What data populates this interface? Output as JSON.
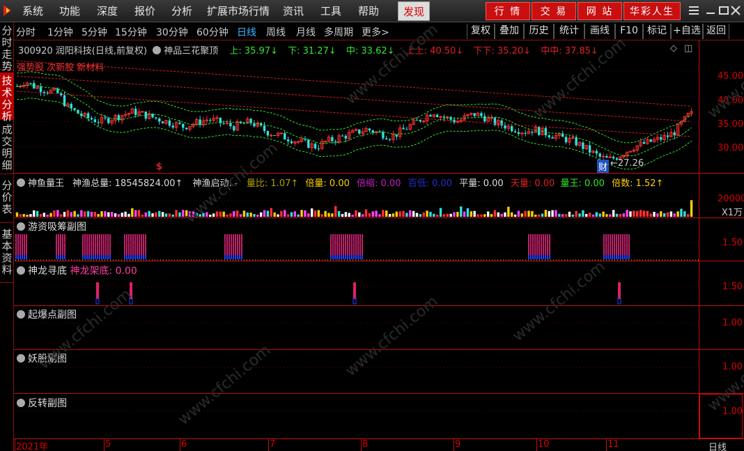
{
  "menubar": {
    "items": [
      "系统",
      "功能",
      "深度",
      "报价",
      "分析",
      "扩展市场行情",
      "资讯",
      "工具",
      "帮助"
    ],
    "highlight": "发现",
    "right_buttons": [
      "行 情",
      "交 易",
      "网 站",
      "华彩人生"
    ]
  },
  "left_rail": {
    "tabs": [
      "分时走势",
      "技术分析",
      "成交明细",
      "分价表",
      "基本资料"
    ],
    "active": "技术分析"
  },
  "periods": {
    "items": [
      "分时",
      "1分钟",
      "5分钟",
      "15分钟",
      "30分钟",
      "60分钟",
      "日线",
      "周线",
      "月线",
      "多周期",
      "更多>"
    ],
    "active": "日线"
  },
  "toolbar": {
    "buttons": [
      "复权",
      "叠加",
      "历史",
      "统计",
      "画线",
      "F10",
      "标记",
      "+自选",
      "返回"
    ]
  },
  "main_chart": {
    "code": "300920",
    "name": "润阳科技(日线,前复权)",
    "indicator": "神品三花聚顶",
    "upper": "上: 35.97↓",
    "lower": "下: 31.27↓",
    "mid": "中: 33.62↓",
    "upup": "上上: 40.50↓",
    "downdown": "下下: 35.20↓",
    "midmid": "中中: 37.85↓",
    "tags": "强势股 次新股 新材料",
    "low_label": "←27.26",
    "cai_badge": "财",
    "s_marker": "$",
    "y_labels": [
      "45.00",
      "40.00",
      "35.00",
      "30.00"
    ]
  },
  "volume_panel": {
    "title": "神鱼量王",
    "total_label": "神渔总量: 18545824.00↑",
    "start_label": "神渔启动: -",
    "ratio": "量比: 1.07↑",
    "multi": "倍量: 0.00",
    "shrink": "倍缩: 0.00",
    "lowest": "百低: 0.00",
    "flat": "平量: 0.00",
    "sky": "天量: 0.00",
    "king": "量王: 0.00",
    "times": "倍数: 1.52↑",
    "y_label": "20000",
    "unit": "X1万"
  },
  "sub_panels": [
    {
      "title": "游资吸筹副图",
      "y_label": "1.50"
    },
    {
      "title": "神龙寻底",
      "value": "神龙架底: 0.00",
      "y_label": "1.50"
    },
    {
      "title": "起爆点副图",
      "y_label": "1.00"
    },
    {
      "title": "妖股副图",
      "y_label": "1.00"
    },
    {
      "title": "反转副图",
      "y_label": "1.00"
    }
  ],
  "dates": [
    "2021年",
    "5",
    "6",
    "7",
    "8",
    "9",
    "10",
    "11"
  ],
  "period_indicator": "日线",
  "watermark": "www.cfchi.com",
  "chart_data": {
    "type": "candlestick",
    "title": "300920 润阳科技(日线,前复权)",
    "ylim": [
      26,
      48
    ],
    "trend": [
      42,
      43,
      42,
      41.5,
      41,
      40.5,
      38,
      37,
      36,
      35.5,
      35,
      35.5,
      36,
      36.5,
      37,
      36.5,
      36,
      35.5,
      35,
      34.5,
      34,
      34.5,
      35,
      35.5,
      35,
      34.5,
      34,
      34.5,
      35,
      34,
      33,
      32.5,
      32,
      31.5,
      31,
      30.5,
      30,
      31,
      31.5,
      32,
      32.5,
      33,
      33.5,
      33,
      32.5,
      32,
      33,
      34,
      35,
      36,
      37,
      36,
      35.5,
      35,
      36,
      36.5,
      36,
      35,
      34.5,
      34,
      33.5,
      33,
      33.5,
      33,
      32.5,
      32,
      31.5,
      31,
      30,
      29,
      28,
      27.5,
      28,
      29,
      30,
      30.5,
      31,
      31.5,
      32,
      33,
      35,
      37
    ],
    "low": 27.26
  }
}
